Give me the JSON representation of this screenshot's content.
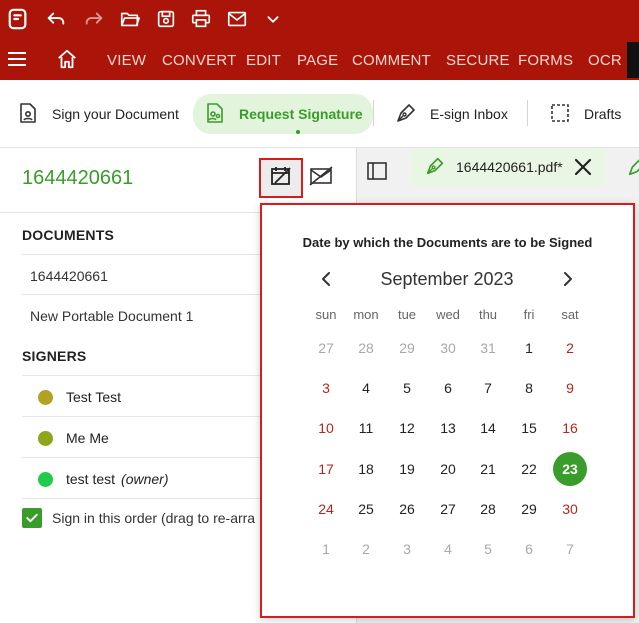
{
  "menubar": {
    "items": [
      "VIEW",
      "CONVERT",
      "EDIT",
      "PAGE",
      "COMMENT",
      "SECURE",
      "FORMS",
      "OCR"
    ]
  },
  "ribbon": {
    "sign_your_document": "Sign your Document",
    "request_signature": "Request Signature",
    "esign_inbox": "E-sign Inbox",
    "drafts": "Drafts"
  },
  "panel": {
    "doc_id": "1644420661",
    "documents_title": "DOCUMENTS",
    "documents": [
      "1644420661",
      "New Portable Document 1"
    ],
    "signers_title": "SIGNERS",
    "signers": [
      {
        "name": "Test Test",
        "owner": "",
        "color": "#b3a123"
      },
      {
        "name": "Me Me",
        "owner": "",
        "color": "#8fa51c"
      },
      {
        "name": "test test",
        "owner": "(owner)",
        "color": "#1fcb4a"
      }
    ],
    "order_label": "Sign in this order (drag to re-arra"
  },
  "tabs": {
    "file_name": "1644420661.pdf*"
  },
  "calendar": {
    "title": "Date by which the Documents are to be Signed",
    "month_label": "September 2023",
    "weekdays": [
      "sun",
      "mon",
      "tue",
      "wed",
      "thu",
      "fri",
      "sat"
    ],
    "selected_day": "23",
    "weeks": [
      [
        "27",
        "28",
        "29",
        "30",
        "31",
        "1",
        "2"
      ],
      [
        "3",
        "4",
        "5",
        "6",
        "7",
        "8",
        "9"
      ],
      [
        "10",
        "11",
        "12",
        "13",
        "14",
        "15",
        "16"
      ],
      [
        "17",
        "18",
        "19",
        "20",
        "21",
        "22",
        "23"
      ],
      [
        "24",
        "25",
        "26",
        "27",
        "28",
        "29",
        "30"
      ],
      [
        "1",
        "2",
        "3",
        "4",
        "5",
        "6",
        "7"
      ]
    ]
  },
  "colors": {
    "brand_red": "#ab1509",
    "accent_green": "#3a9c2a",
    "highlight_red": "#d61c1c"
  }
}
